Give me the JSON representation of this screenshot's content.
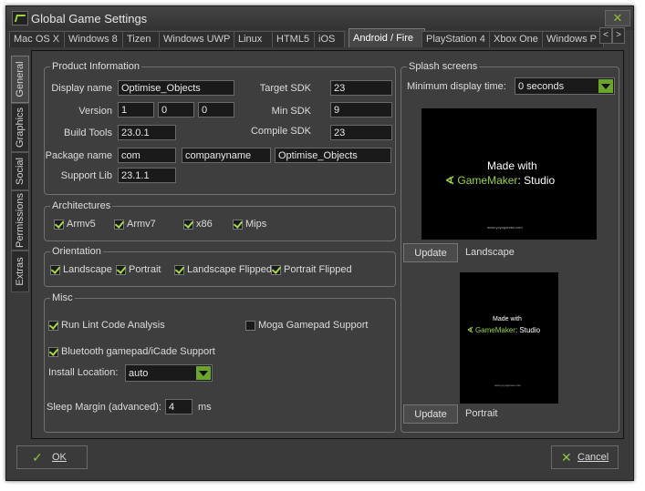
{
  "window": {
    "title": "Global Game Settings",
    "close_glyph": "✕"
  },
  "tabs": [
    {
      "label": "Mac OS X"
    },
    {
      "label": "Windows 8"
    },
    {
      "label": "Tizen"
    },
    {
      "label": "Windows UWP"
    },
    {
      "label": "Linux"
    },
    {
      "label": "HTML5"
    },
    {
      "label": "iOS"
    },
    {
      "label": "Android / Fire"
    },
    {
      "label": "PlayStation 4"
    },
    {
      "label": "Xbox One"
    },
    {
      "label": "Windows P"
    }
  ],
  "tab_arrows": {
    "left": "<",
    "right": ">"
  },
  "side_tabs": [
    {
      "label": "General"
    },
    {
      "label": "Graphics"
    },
    {
      "label": "Social"
    },
    {
      "label": "Permissions"
    },
    {
      "label": "Extras"
    }
  ],
  "product": {
    "title": "Product Information",
    "display_name_label": "Display name",
    "display_name": "Optimise_Objects",
    "version_label": "Version",
    "version": [
      "1",
      "0",
      "0"
    ],
    "build_tools_label": "Build Tools",
    "build_tools": "23.0.1",
    "package_name_label": "Package name",
    "package": [
      "com",
      "companyname",
      "Optimise_Objects"
    ],
    "support_lib_label": "Support Lib",
    "support_lib": "23.1.1",
    "target_sdk_label": "Target SDK",
    "target_sdk": "23",
    "min_sdk_label": "Min SDK",
    "min_sdk": "9",
    "compile_sdk_label": "Compile SDK",
    "compile_sdk": "23"
  },
  "architectures": {
    "title": "Architectures",
    "items": [
      {
        "label": "Armv5",
        "checked": true
      },
      {
        "label": "Armv7",
        "checked": true
      },
      {
        "label": "x86",
        "checked": true
      },
      {
        "label": "Mips",
        "checked": true
      }
    ]
  },
  "orientation": {
    "title": "Orientation",
    "items": [
      {
        "label": "Landscape",
        "checked": true
      },
      {
        "label": "Portrait",
        "checked": true
      },
      {
        "label": "Landscape Flipped",
        "checked": true
      },
      {
        "label": "Portrait Flipped",
        "checked": true
      }
    ]
  },
  "misc": {
    "title": "Misc",
    "lint_label": "Run Lint Code Analysis",
    "lint_checked": true,
    "moga_label": "Moga Gamepad Support",
    "moga_checked": false,
    "bluetooth_label": "Bluetooth gamepad/iCade Support",
    "bluetooth_checked": true,
    "install_location_label": "Install Location:",
    "install_location": "auto",
    "sleep_margin_label": "Sleep Margin (advanced):",
    "sleep_margin": "4",
    "sleep_margin_unit": "ms"
  },
  "splash": {
    "title": "Splash screens",
    "min_time_label": "Minimum display time:",
    "min_time": "0 seconds",
    "made_with": "Made with",
    "brand": "GameMaker",
    "brand_suffix": ": Studio",
    "tiny_text": "www.yoyogames.com",
    "landscape_update": "Update",
    "landscape_label": "Landscape",
    "portrait_update": "Update",
    "portrait_label": "Portrait"
  },
  "footer": {
    "ok_label": "OK",
    "cancel_label": "Cancel"
  },
  "colors": {
    "accent": "#8bc53f",
    "background": "#3a3a3a",
    "field": "#1a1a1a"
  }
}
